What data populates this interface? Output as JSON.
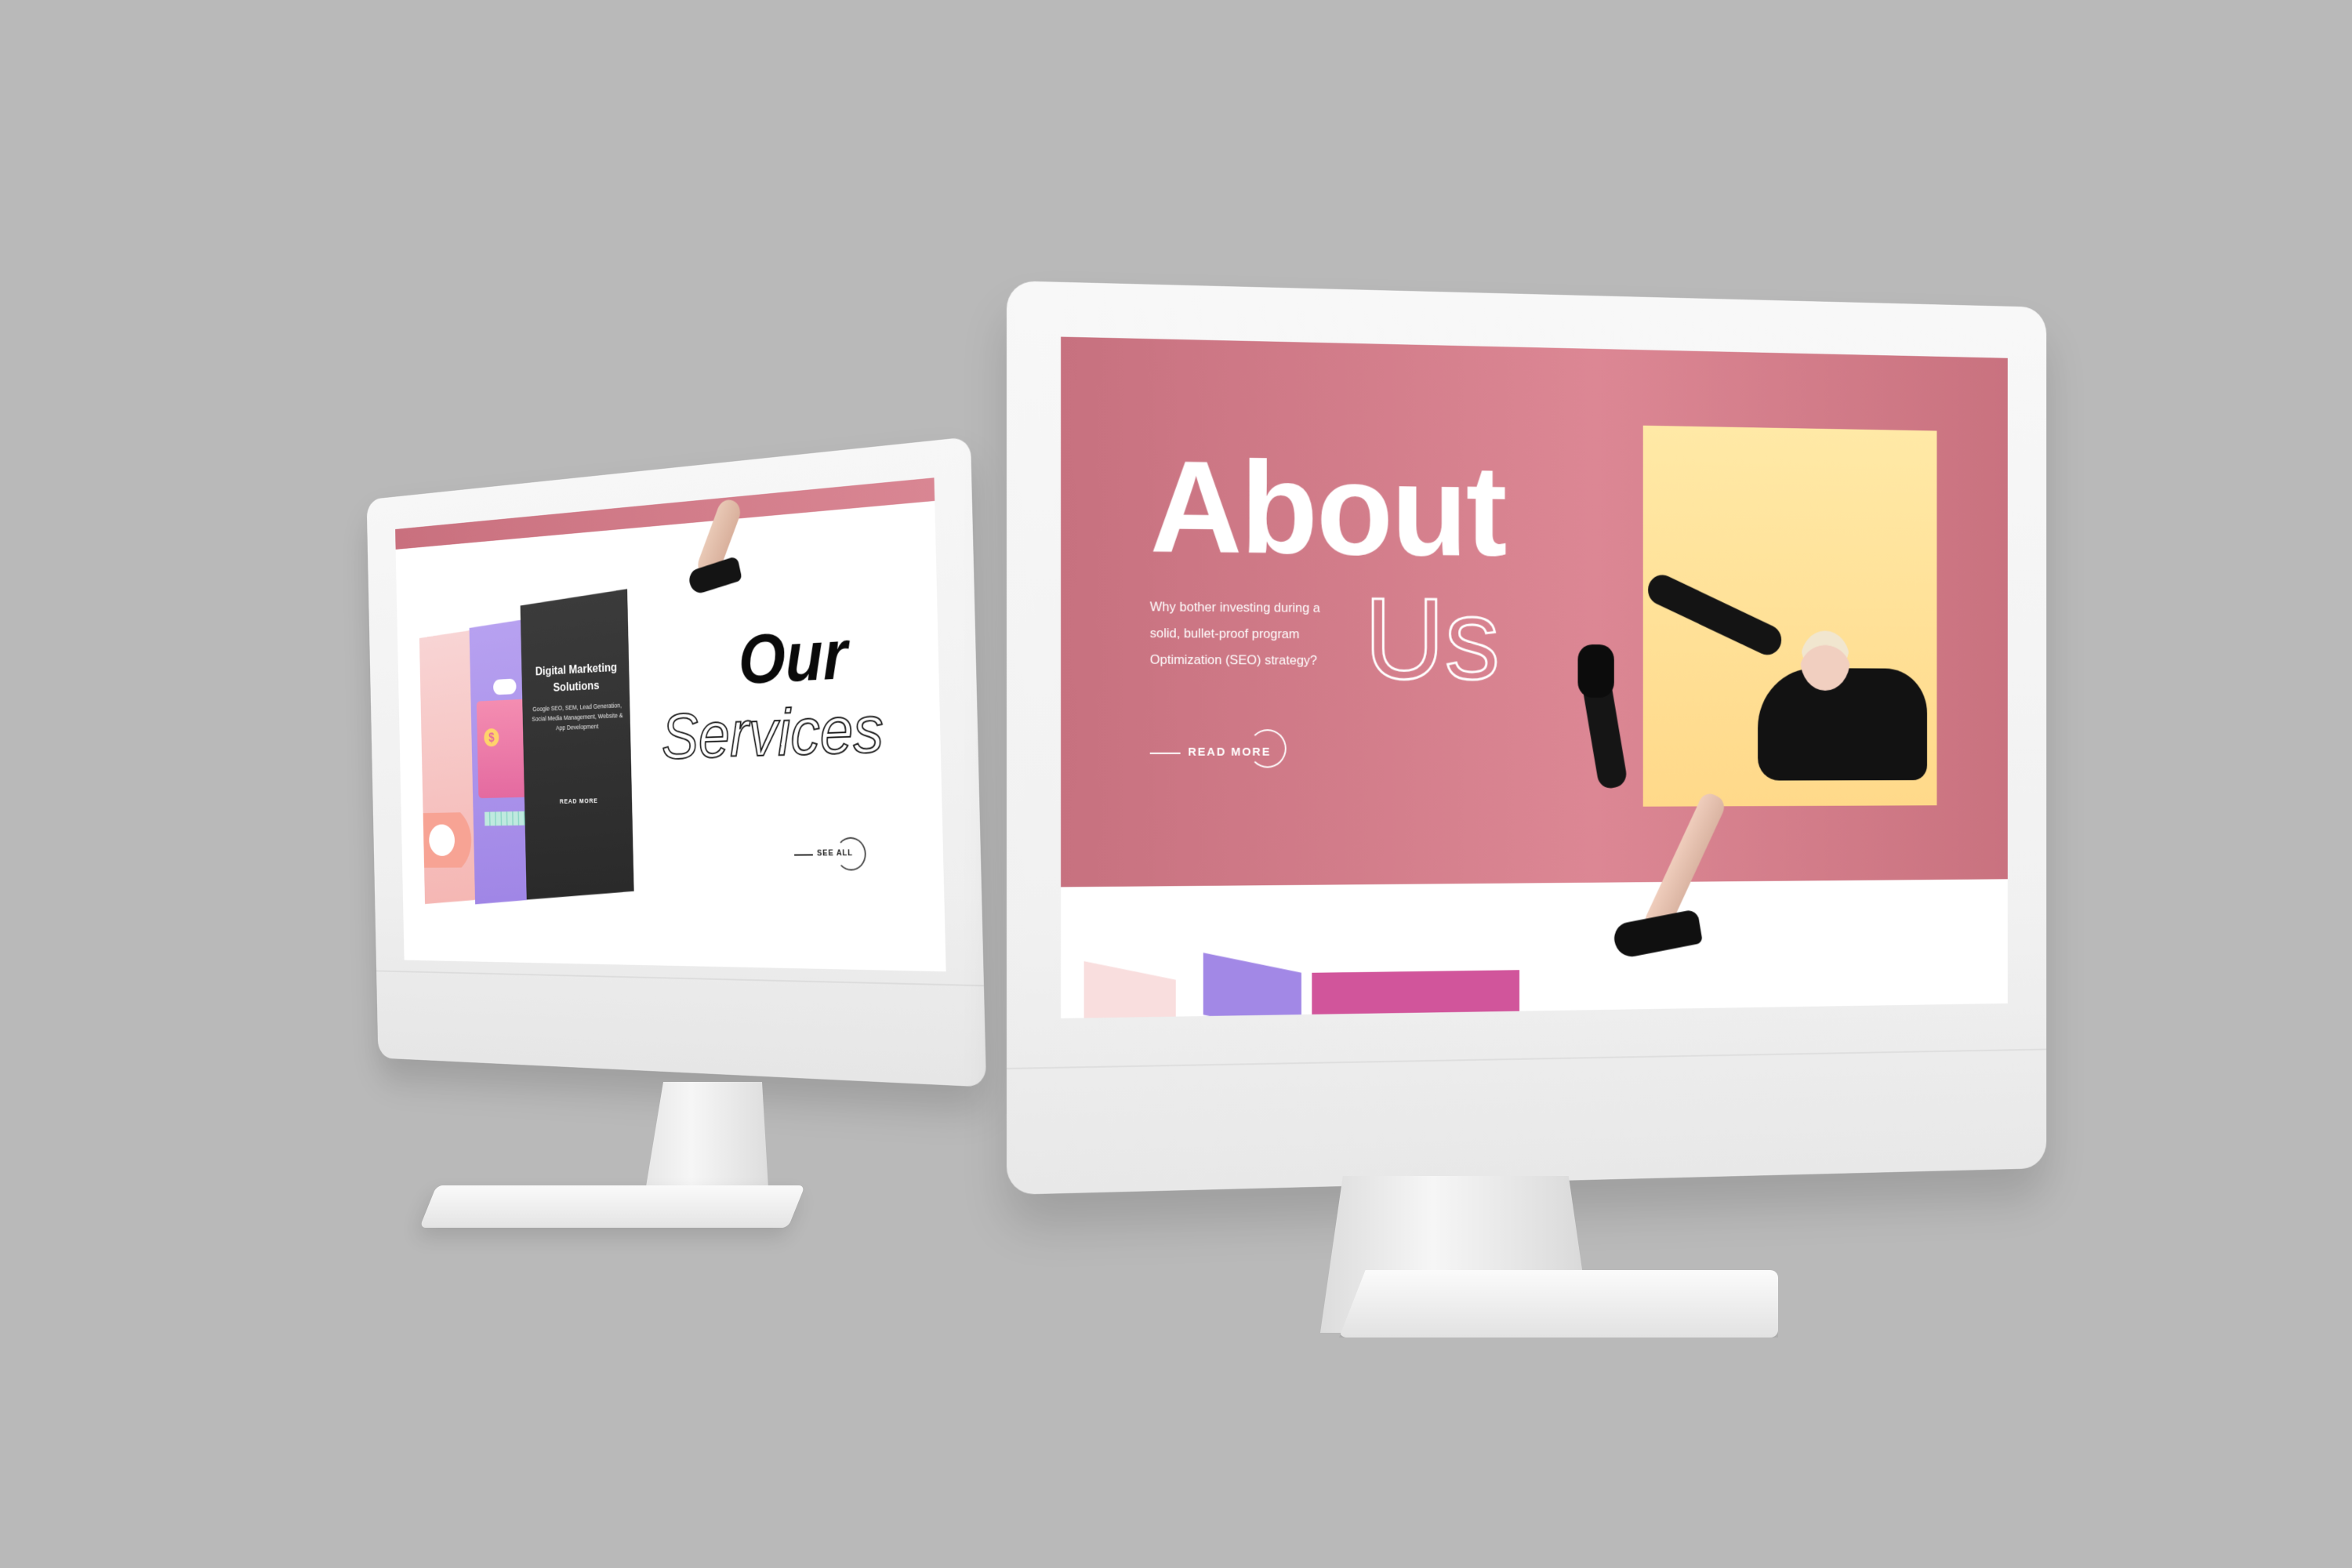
{
  "left_screen": {
    "heading_line1": "Our",
    "heading_line2": "Services",
    "see_all": "SEE ALL",
    "card": {
      "title": "Digital Marketing Solutions",
      "subtitle": "Google SEO, SEM, Lead Generation, Social Media Management, Website & App Development",
      "read_more": "READ MORE"
    }
  },
  "right_screen": {
    "heading_line1": "About",
    "heading_line2": "Us",
    "description": "Why bother investing during a solid, bullet-proof program Optimization (SEO) strategy?",
    "read_more": "READ MORE"
  },
  "colors": {
    "background": "#b9b9b9",
    "accent_pink": "#d98693",
    "accent_yellow": "#ffe29a",
    "accent_purple": "#a288e6",
    "accent_magenta": "#d1559b"
  }
}
